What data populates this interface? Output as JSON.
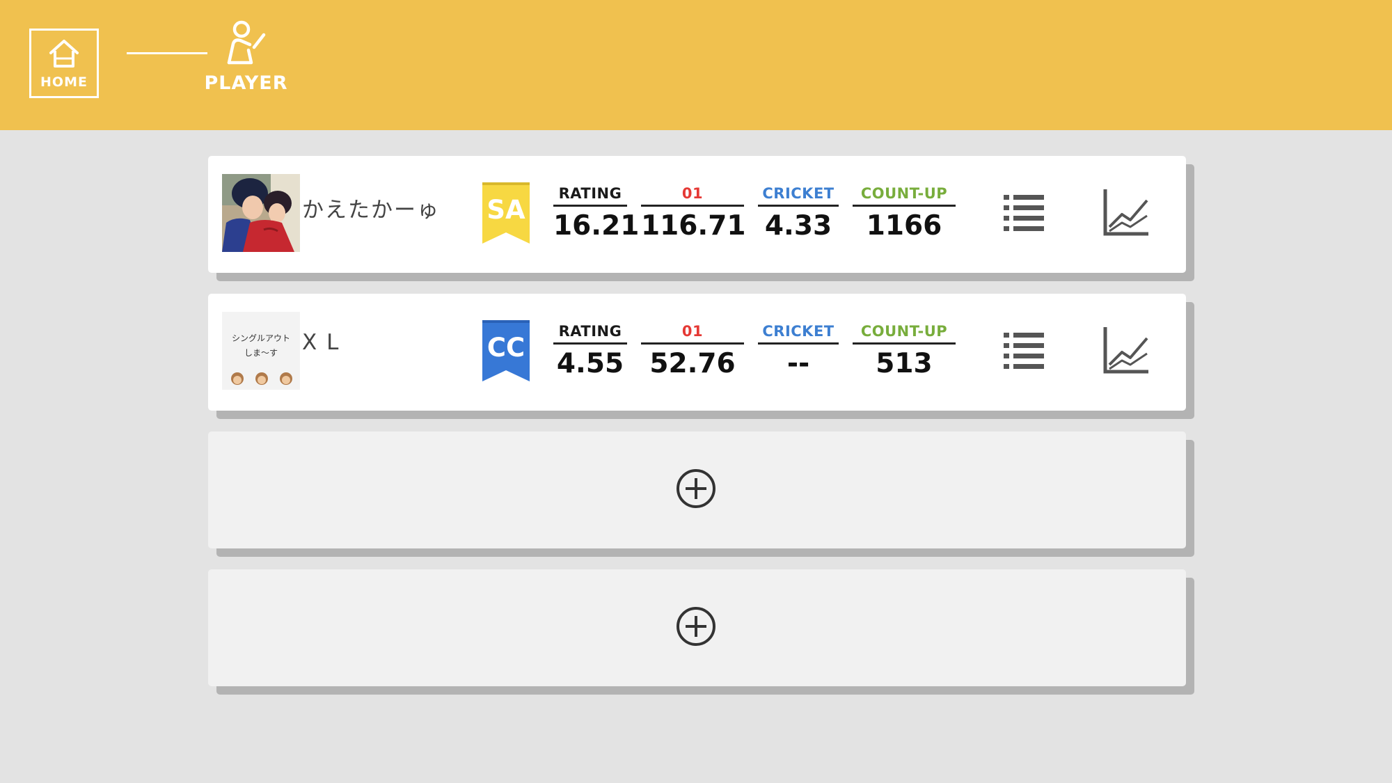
{
  "nav": {
    "home_label": "HOME",
    "player_label": "PLAYER"
  },
  "players": [
    {
      "name": "かえたかーゅ",
      "avatar_text": [],
      "badge": {
        "text": "SA",
        "color": "#f7d842"
      },
      "stats": {
        "rating": {
          "label": "RATING",
          "value": "16.21"
        },
        "zero_one": {
          "label": "01",
          "value": "116.71"
        },
        "cricket": {
          "label": "CRICKET",
          "value": "4.33"
        },
        "countup": {
          "label": "COUNT-UP",
          "value": "1166"
        }
      }
    },
    {
      "name": "X L",
      "avatar_text": [
        "シングルアウト",
        "しま〜す"
      ],
      "badge": {
        "text": "CC",
        "color": "#3778d6"
      },
      "stats": {
        "rating": {
          "label": "RATING",
          "value": "4.55"
        },
        "zero_one": {
          "label": "01",
          "value": "52.76"
        },
        "cricket": {
          "label": "CRICKET",
          "value": "--"
        },
        "countup": {
          "label": "COUNT-UP",
          "value": "513"
        }
      }
    }
  ],
  "empty_slots": 2,
  "icons": {
    "home": "home-icon",
    "player": "player-icon",
    "list": "list-icon",
    "chart": "line-chart-icon",
    "add": "plus-circle-icon"
  },
  "colors": {
    "header": "#f0c14f",
    "background": "#e3e3e3",
    "zero_one_label": "#e53935",
    "cricket_label": "#3d7fd1",
    "countup_label": "#78ad3c"
  }
}
